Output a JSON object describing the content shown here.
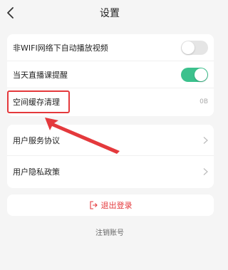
{
  "header": {
    "title": "设置",
    "back_icon": "chevron-left-icon"
  },
  "settings": {
    "autoplay": {
      "label": "非WIFI网络下自动播放视频",
      "enabled": false
    },
    "live_reminder": {
      "label": "当天直播课提醒",
      "enabled": true
    },
    "cache": {
      "label": "空间缓存清理",
      "value": "0B"
    }
  },
  "links": {
    "service_agreement": "用户服务协议",
    "privacy_policy": "用户隐私政策"
  },
  "logout": {
    "label": "退出登录",
    "icon": "logout-icon"
  },
  "cancel_account": "注销账号",
  "colors": {
    "toggle_on": "#3cc18d",
    "toggle_off": "#e5e5e5",
    "danger": "#e4393c",
    "background": "#f5f5f5"
  }
}
